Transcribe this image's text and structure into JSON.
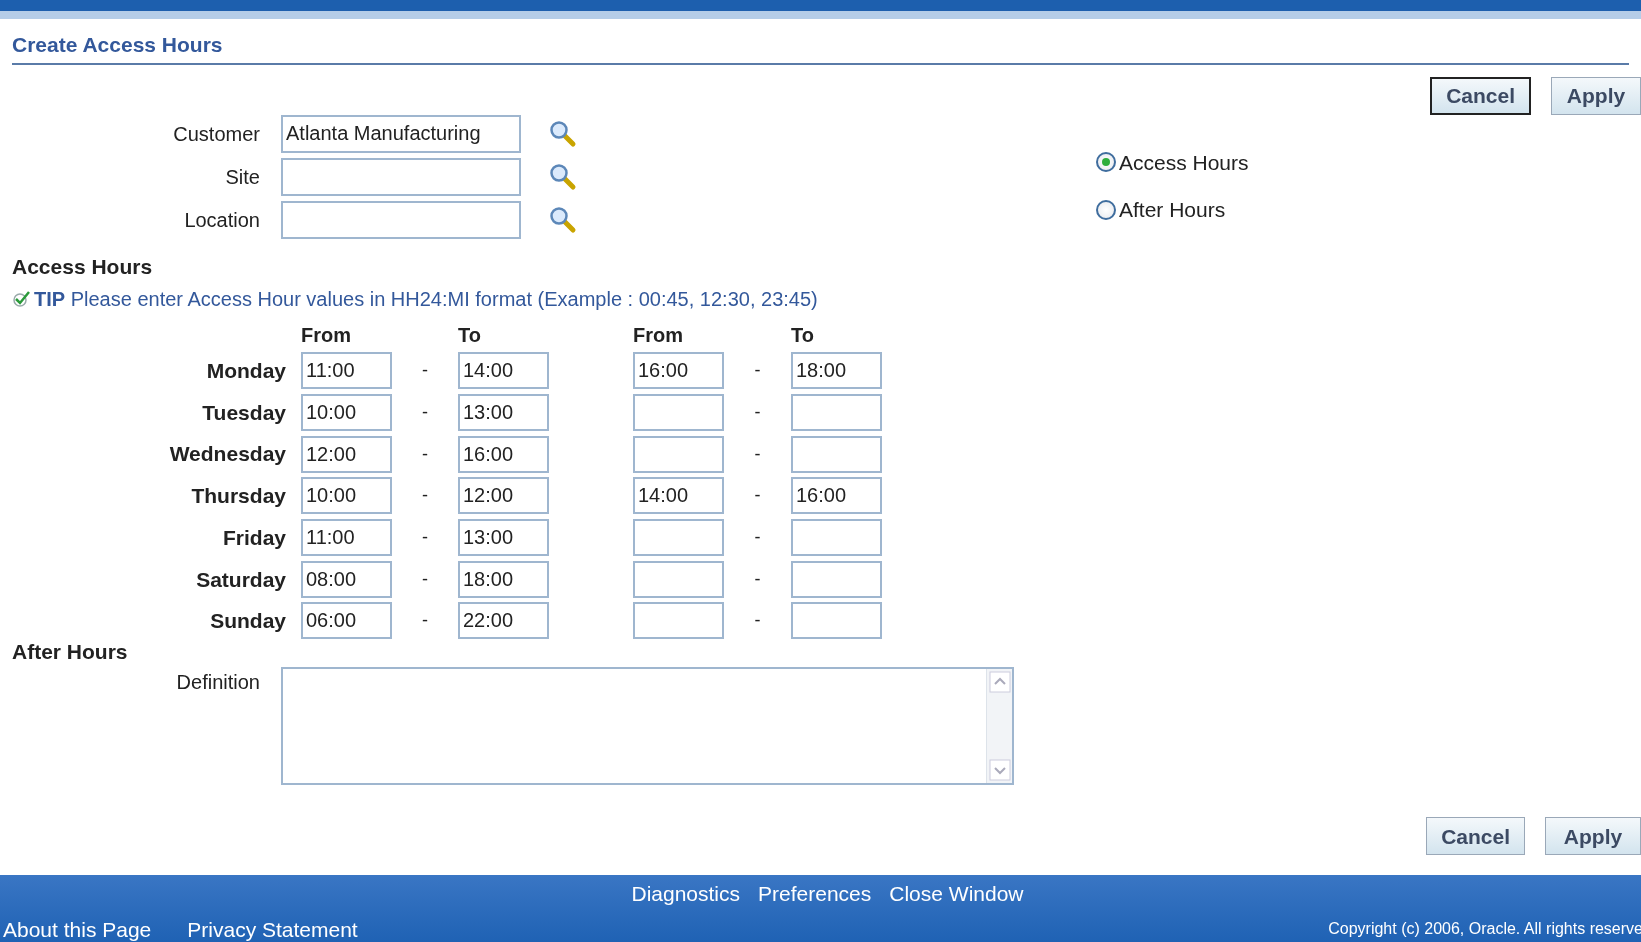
{
  "page_title": "Create Access Hours",
  "buttons": [
    "Cancel",
    "Apply"
  ],
  "fields": [
    {
      "label": "Customer",
      "value": "Atlanta Manufacturing"
    },
    {
      "label": "Site"
    },
    {
      "label": "Location"
    }
  ],
  "mode_options": [
    {
      "label": "Access Hours",
      "selected": true
    },
    {
      "label": "After Hours",
      "selected": false
    }
  ],
  "access_hours": {
    "heading": "Access Hours",
    "tip_label": "TIP",
    "tip": "Please enter Access Hour values in HH24:MI format (Example : 00:45, 12:30, 23:45)",
    "columns": [
      "From",
      "To",
      "From",
      "To"
    ],
    "separator": "-",
    "rows": [
      {
        "day": "Monday",
        "periods": [
          {
            "from": "11:00",
            "to": "14:00"
          },
          {
            "from": "16:00",
            "to": "18:00"
          }
        ]
      },
      {
        "day": "Tuesday",
        "periods": [
          {
            "from": "10:00",
            "to": "13:00"
          }
        ]
      },
      {
        "day": "Wednesday",
        "periods": [
          {
            "from": "12:00",
            "to": "16:00"
          }
        ]
      },
      {
        "day": "Thursday",
        "periods": [
          {
            "from": "10:00",
            "to": "12:00"
          },
          {
            "from": "14:00",
            "to": "16:00"
          }
        ]
      },
      {
        "day": "Friday",
        "periods": [
          {
            "from": "11:00",
            "to": "13:00"
          }
        ]
      },
      {
        "day": "Saturday",
        "periods": [
          {
            "from": "08:00",
            "to": "18:00"
          }
        ]
      },
      {
        "day": "Sunday",
        "periods": [
          {
            "from": "06:00",
            "to": "22:00"
          }
        ]
      }
    ]
  },
  "after_hours": {
    "heading": "After Hours",
    "definition_label": "Definition"
  },
  "bottom_buttons": [
    "Cancel",
    "Apply"
  ],
  "footer": {
    "center_links": [
      "Diagnostics",
      "Preferences",
      "Close Window"
    ],
    "left_links": [
      "About this Page",
      "Privacy Statement"
    ],
    "copyright": "Copyright (c) 2006, Oracle. All rights reserve"
  }
}
